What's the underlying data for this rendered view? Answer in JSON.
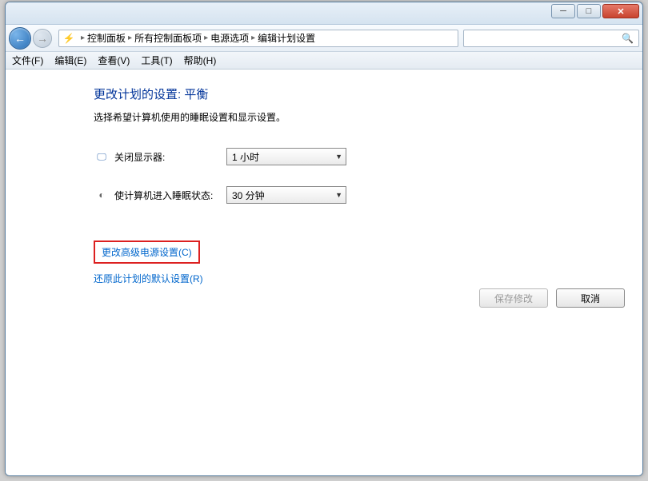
{
  "titlebar": {
    "minimize_glyph": "─",
    "maximize_glyph": "□",
    "close_glyph": "✕"
  },
  "nav": {
    "back_glyph": "←",
    "fwd_glyph": "→",
    "icon_glyph": "⚡"
  },
  "breadcrumb": {
    "sep": "▸",
    "p1": "控制面板",
    "p2": "所有控制面板项",
    "p3": "电源选项",
    "p4": "编辑计划设置"
  },
  "search": {
    "icon_glyph": "🔍"
  },
  "menu": {
    "file": "文件(F)",
    "edit": "编辑(E)",
    "view": "查看(V)",
    "tools": "工具(T)",
    "help": "帮助(H)"
  },
  "main": {
    "heading": "更改计划的设置: 平衡",
    "subtext": "选择希望计算机使用的睡眠设置和显示设置。",
    "row_display": {
      "label": "关闭显示器:",
      "value": "1 小时",
      "icon": "🖵"
    },
    "row_sleep": {
      "label": "使计算机进入睡眠状态:",
      "value": "30 分钟",
      "icon": "◐"
    },
    "link_advanced": "更改高级电源设置(C)",
    "link_restore": "还原此计划的默认设置(R)"
  },
  "buttons": {
    "save": "保存修改",
    "cancel": "取消"
  },
  "dropdown": {
    "arrow": "▼"
  }
}
